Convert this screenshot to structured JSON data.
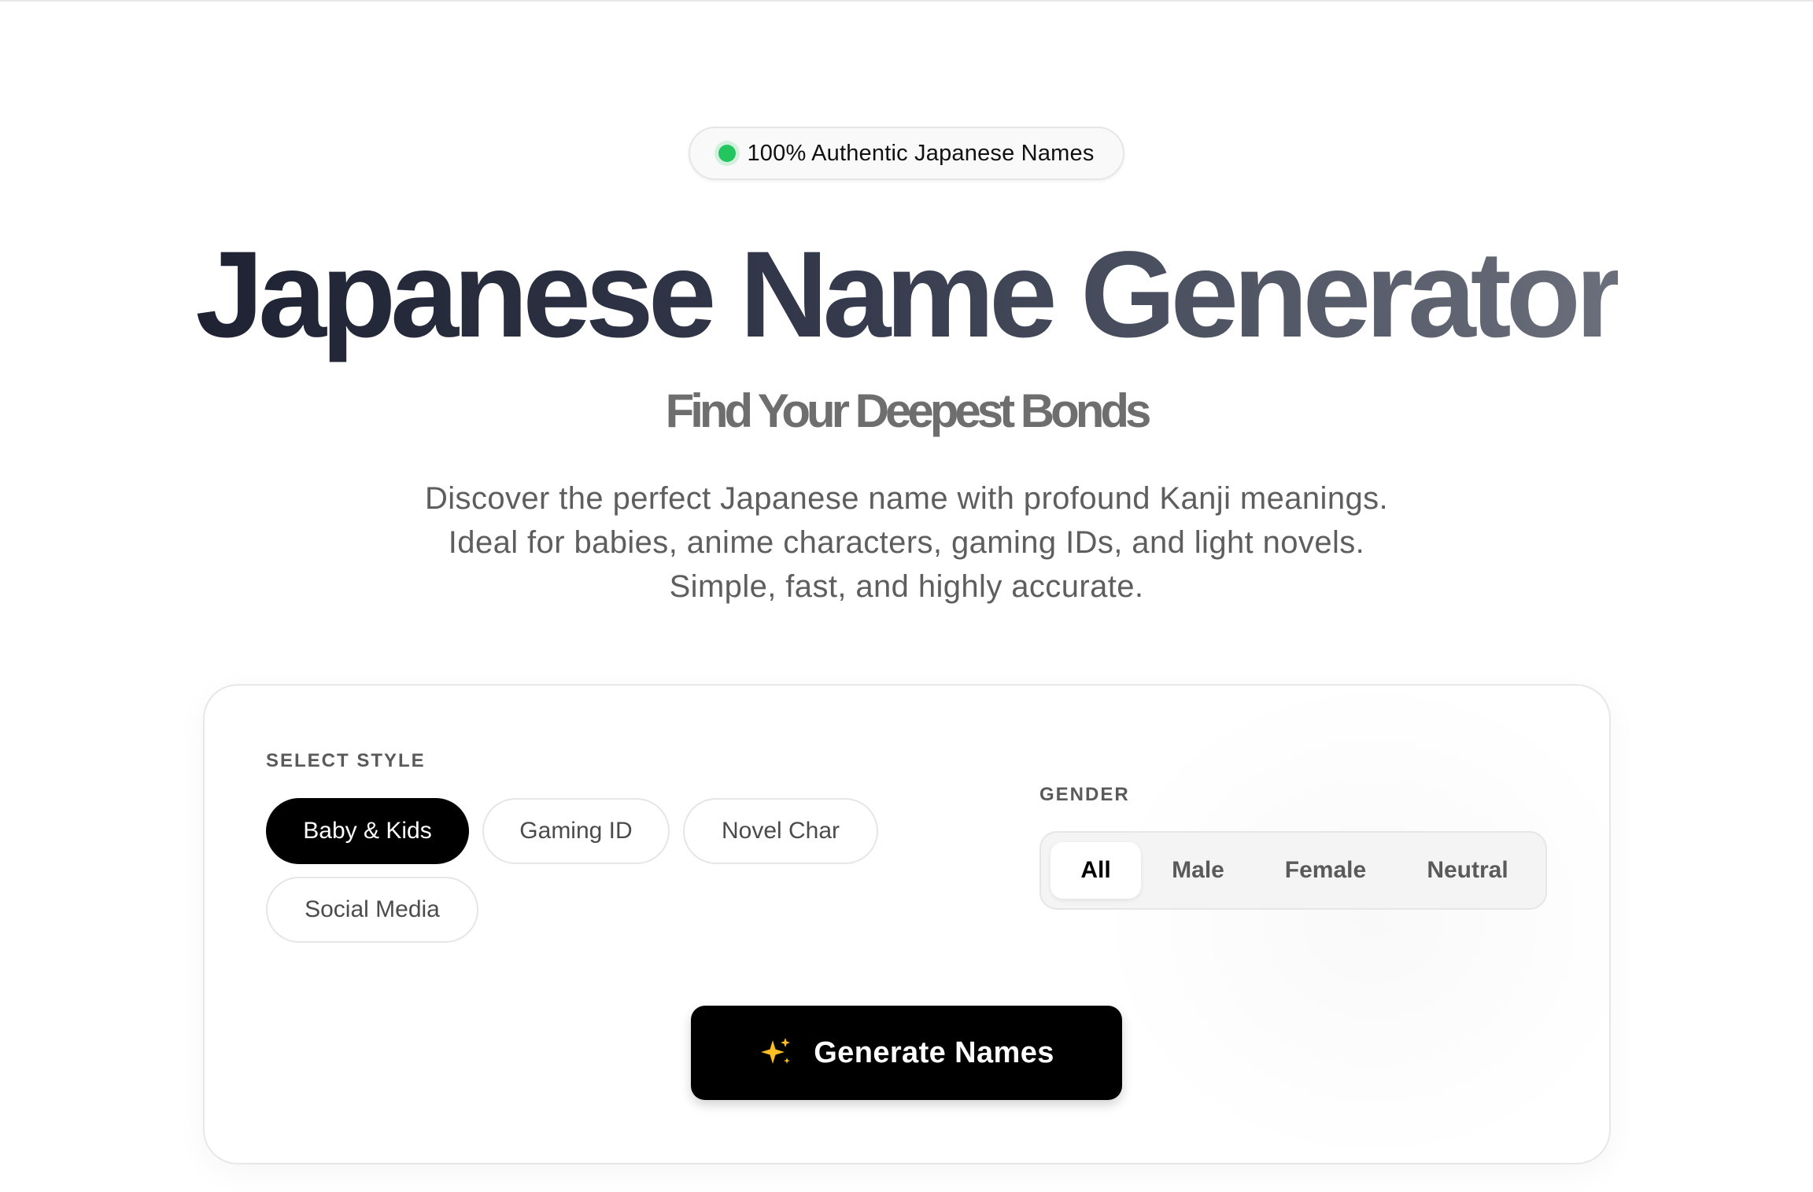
{
  "badge": {
    "text": "100% Authentic Japanese Names",
    "dot_color": "#22c55e"
  },
  "hero": {
    "title": "Japanese Name Generator",
    "subtitle": "Find Your Deepest Bonds",
    "description_lines": [
      "Discover the perfect Japanese name with profound Kanji meanings.",
      "Ideal for babies, anime characters, gaming IDs, and light novels.",
      "Simple, fast, and highly accurate."
    ]
  },
  "style_section": {
    "label": "SELECT STYLE",
    "options": [
      {
        "label": "Baby & Kids",
        "selected": true
      },
      {
        "label": "Gaming ID",
        "selected": false
      },
      {
        "label": "Novel Char",
        "selected": false
      },
      {
        "label": "Social Media",
        "selected": false
      }
    ]
  },
  "gender_section": {
    "label": "GENDER",
    "options": [
      {
        "label": "All",
        "selected": true
      },
      {
        "label": "Male",
        "selected": false
      },
      {
        "label": "Female",
        "selected": false
      },
      {
        "label": "Neutral",
        "selected": false
      }
    ]
  },
  "generate_button": {
    "label": "Generate Names",
    "icon": "sparkles-icon",
    "icon_color": "#fbbf24"
  },
  "colors": {
    "accent": "#000000",
    "title_gradient": [
      "#1e2232",
      "#6b6f7b"
    ]
  }
}
